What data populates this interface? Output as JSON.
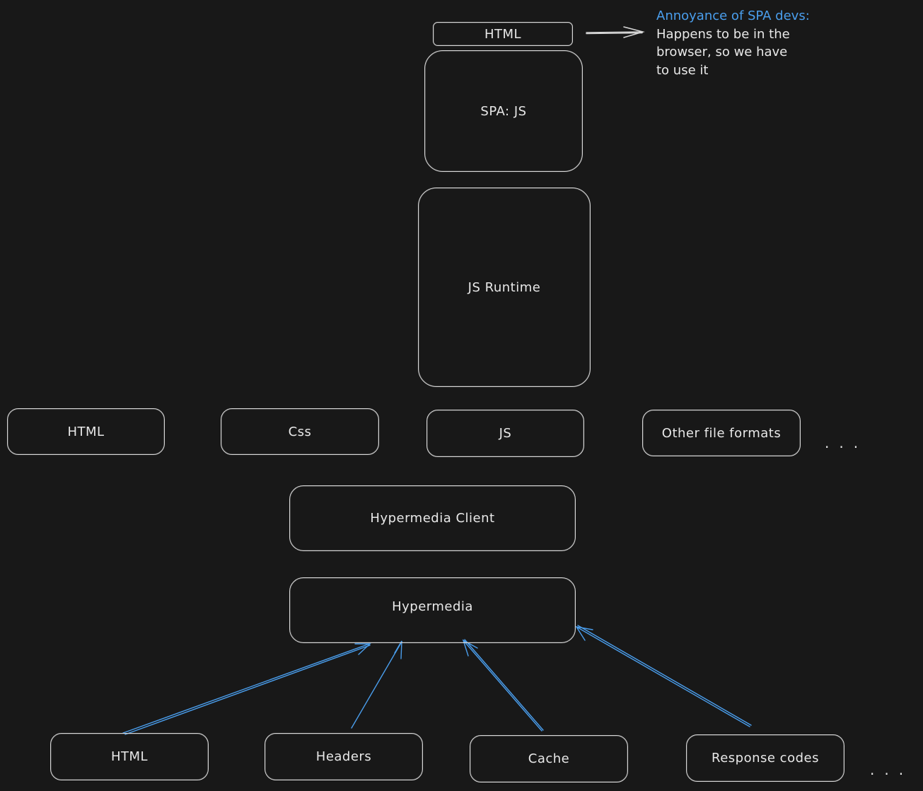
{
  "colors": {
    "background": "#181818",
    "stroke": "#d8d8d8",
    "accent": "#4a9eed"
  },
  "top": {
    "html_label": "HTML",
    "spa_label": "SPA: JS",
    "runtime_label": "JS Runtime"
  },
  "annotation": {
    "title": "Annoyance of SPA devs:",
    "body": "Happens to be in the\nbrowser, so we have\nto use it"
  },
  "formats": {
    "items": [
      "HTML",
      "Css",
      "JS",
      "Other file formats"
    ],
    "ellipsis": "..."
  },
  "client": {
    "label": "Hypermedia Client"
  },
  "hypermedia": {
    "label": "Hypermedia"
  },
  "components": {
    "items": [
      "HTML",
      "Headers",
      "Cache",
      "Response codes"
    ],
    "ellipsis": "..."
  }
}
